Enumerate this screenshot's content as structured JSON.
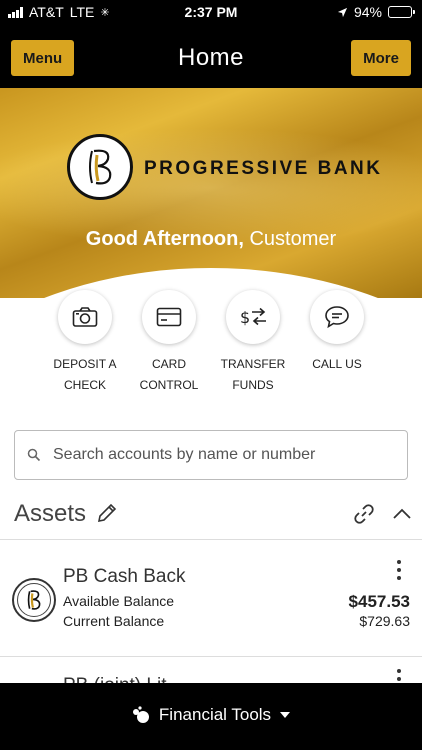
{
  "status_bar": {
    "carrier": "AT&T",
    "network": "LTE",
    "time": "2:37 PM",
    "battery": "94%",
    "battery_level": 0.94
  },
  "nav": {
    "menu_label": "Menu",
    "title": "Home",
    "more_label": "More"
  },
  "hero": {
    "bank_name": "PROGRESSIVE BANK",
    "greeting": "Good Afternoon,",
    "customer": "Customer"
  },
  "actions": [
    {
      "label": "DEPOSIT A\nCHECK",
      "icon": "camera-icon"
    },
    {
      "label": "CARD\nCONTROL",
      "icon": "credit-card-icon"
    },
    {
      "label": "TRANSFER\nFUNDS",
      "icon": "transfer-dollar-icon"
    },
    {
      "label": "CALL US",
      "icon": "chat-bubble-icon"
    }
  ],
  "search": {
    "placeholder": "Search accounts by name or number"
  },
  "assets": {
    "title": "Assets"
  },
  "accounts": [
    {
      "name": "PB Cash Back",
      "available_label": "Available Balance",
      "current_label": "Current Balance",
      "available_value": "$457.53",
      "current_value": "$729.63"
    },
    {
      "name": "PB (joint) Lit..."
    }
  ],
  "bottom_bar": {
    "label": "Financial Tools"
  },
  "colors": {
    "accent": "#d9a520",
    "nav_bg": "#000000"
  }
}
